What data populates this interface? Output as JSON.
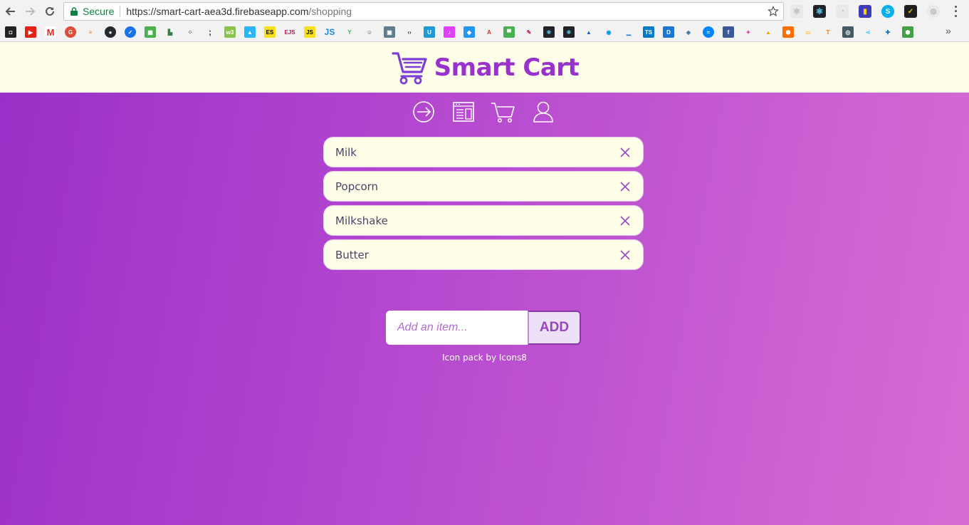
{
  "browser": {
    "secure_label": "Secure",
    "url_host": "https://smart-cart-aea3d.firebaseapp.com",
    "url_path": "/shopping",
    "bookmarks_more": "»"
  },
  "app": {
    "brand_name": "Smart Cart",
    "nav": [
      "sign-in",
      "news",
      "cart",
      "profile"
    ],
    "items": [
      {
        "name": "Milk"
      },
      {
        "name": "Popcorn"
      },
      {
        "name": "Milkshake"
      },
      {
        "name": "Butter"
      }
    ],
    "add_input_placeholder": "Add an item...",
    "add_button_label": "ADD",
    "credit": "Icon pack by Icons8",
    "colors": {
      "brand": "#9932cc",
      "header_bg": "#fefee9",
      "gradient_start": "#9b30c8",
      "gradient_end": "#d76dd4"
    }
  }
}
